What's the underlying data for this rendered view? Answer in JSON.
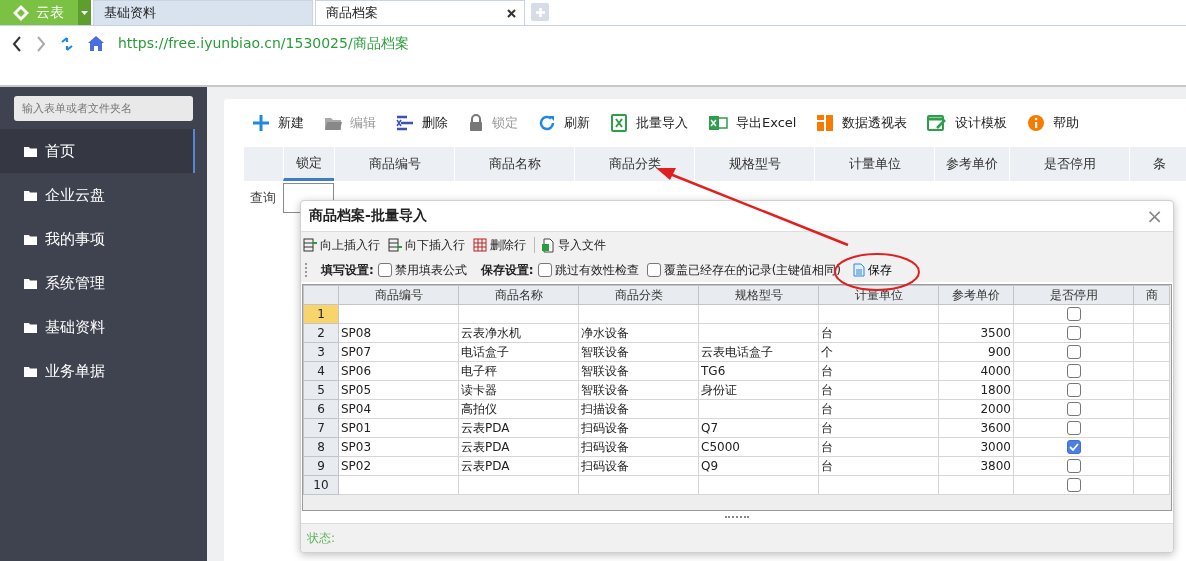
{
  "browser": {
    "app_menu": "云表",
    "tabs": [
      {
        "label": "基础资料",
        "selected": false
      },
      {
        "label": "商品档案",
        "selected": true
      }
    ],
    "url": "https://free.iyunbiao.cn/1530025/商品档案"
  },
  "sidebar": {
    "search_placeholder": "输入表单或者文件夹名",
    "items": [
      {
        "label": "首页",
        "selected": true
      },
      {
        "label": "企业云盘",
        "selected": false
      },
      {
        "label": "我的事项",
        "selected": false
      },
      {
        "label": "系统管理",
        "selected": false
      },
      {
        "label": "基础资料",
        "selected": false
      },
      {
        "label": "业务单据",
        "selected": false
      }
    ]
  },
  "toolbar": [
    {
      "label": "新建",
      "kind": "plus",
      "disabled": false
    },
    {
      "label": "编辑",
      "kind": "folder",
      "disabled": true
    },
    {
      "label": "删除",
      "kind": "delete",
      "disabled": false
    },
    {
      "label": "锁定",
      "kind": "lock",
      "disabled": true
    },
    {
      "label": "刷新",
      "kind": "refresh",
      "disabled": false
    },
    {
      "label": "批量导入",
      "kind": "import",
      "disabled": false
    },
    {
      "label": "导出Excel",
      "kind": "excel",
      "disabled": false
    },
    {
      "label": "数据透视表",
      "kind": "pivot",
      "disabled": false
    },
    {
      "label": "设计模板",
      "kind": "design",
      "disabled": false
    },
    {
      "label": "帮助",
      "kind": "help",
      "disabled": false
    }
  ],
  "grid": {
    "columns": [
      {
        "label": "锁定",
        "selected": true
      },
      {
        "label": "商品编号",
        "selected": false
      },
      {
        "label": "商品名称",
        "selected": false
      },
      {
        "label": "商品分类",
        "selected": false
      },
      {
        "label": "规格型号",
        "selected": false
      },
      {
        "label": "计量单位",
        "selected": false
      },
      {
        "label": "参考单价",
        "selected": false
      },
      {
        "label": "是否停用",
        "selected": false
      },
      {
        "label": "条",
        "selected": false
      }
    ],
    "query_label": "查询"
  },
  "dialog": {
    "title": "商品档案-批量导入",
    "close": "×",
    "toolbar": [
      {
        "label": "向上插入行",
        "kind": "insert-up"
      },
      {
        "label": "向下插入行",
        "kind": "insert-down"
      },
      {
        "label": "删除行",
        "kind": "delete-row"
      },
      {
        "label": "导入文件",
        "kind": "file"
      }
    ],
    "settings": [
      {
        "kind": "label",
        "text": "填写设置:"
      },
      {
        "kind": "checkbox",
        "text": "禁用填表公式",
        "checked": false
      },
      {
        "kind": "label",
        "text": "保存设置:"
      },
      {
        "kind": "checkbox",
        "text": "跳过有效性检查",
        "checked": false
      },
      {
        "kind": "checkbox",
        "text": "覆盖已经存在的记录(主键值相同)",
        "checked": false
      },
      {
        "kind": "button",
        "text": "保存"
      }
    ],
    "columns": [
      "商品编号",
      "商品名称",
      "商品分类",
      "规格型号",
      "计量单位",
      "参考单价",
      "是否停用",
      "商"
    ],
    "rows": [
      {
        "number": "1",
        "selected": true,
        "cells": [
          "",
          "",
          "",
          "",
          "",
          ""
        ],
        "disabled": false
      },
      {
        "number": "2",
        "selected": false,
        "cells": [
          "SP08",
          "云表净水机",
          "净水设备",
          "",
          "台",
          "3500"
        ],
        "disabled": false
      },
      {
        "number": "3",
        "selected": false,
        "cells": [
          "SP07",
          "电话盒子",
          "智联设备",
          "云表电话盒子",
          "个",
          "900"
        ],
        "disabled": false
      },
      {
        "number": "4",
        "selected": false,
        "cells": [
          "SP06",
          "电子秤",
          "智联设备",
          "TG6",
          "台",
          "4000"
        ],
        "disabled": false
      },
      {
        "number": "5",
        "selected": false,
        "cells": [
          "SP05",
          "读卡器",
          "智联设备",
          "身份证",
          "台",
          "1800"
        ],
        "disabled": false
      },
      {
        "number": "6",
        "selected": false,
        "cells": [
          "SP04",
          "高拍仪",
          "扫描设备",
          "",
          "台",
          "2000"
        ],
        "disabled": false
      },
      {
        "number": "7",
        "selected": false,
        "cells": [
          "SP01",
          "云表PDA",
          "扫码设备",
          "Q7",
          "台",
          "3600"
        ],
        "disabled": false
      },
      {
        "number": "8",
        "selected": false,
        "cells": [
          "SP03",
          "云表PDA",
          "扫码设备",
          "C5000",
          "台",
          "3000"
        ],
        "disabled": true
      },
      {
        "number": "9",
        "selected": false,
        "cells": [
          "SP02",
          "云表PDA",
          "扫码设备",
          "Q9",
          "台",
          "3800"
        ],
        "disabled": false
      },
      {
        "number": "10",
        "selected": false,
        "cells": [
          "",
          "",
          "",
          "",
          "",
          ""
        ],
        "disabled": false
      }
    ],
    "status_label": "状态:"
  }
}
